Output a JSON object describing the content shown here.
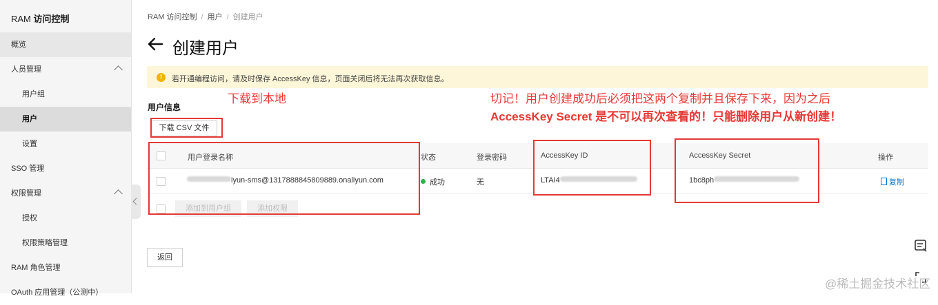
{
  "sidebar": {
    "title_prefix": "RAM",
    "title_main": "访问控制",
    "items": [
      {
        "label": "概览"
      },
      {
        "label": "人员管理"
      },
      {
        "label": "用户组"
      },
      {
        "label": "用户"
      },
      {
        "label": "设置"
      },
      {
        "label": "SSO 管理"
      },
      {
        "label": "权限管理"
      },
      {
        "label": "授权"
      },
      {
        "label": "权限策略管理"
      },
      {
        "label": "RAM 角色管理"
      },
      {
        "label": "OAuth 应用管理（公测中）"
      }
    ]
  },
  "breadcrumb": {
    "items": [
      "RAM 访问控制",
      "用户",
      "创建用户"
    ]
  },
  "page": {
    "title": "创建用户"
  },
  "notice": {
    "icon": "warning-icon",
    "text": "若开通编程访问，请及时保存 AccessKey 信息，页面关闭后将无法再次获取信息。"
  },
  "section": {
    "title": "用户信息"
  },
  "buttons": {
    "download_csv": "下载 CSV 文件",
    "add_to_group": "添加到用户组",
    "add_permission": "添加权限",
    "back": "返回"
  },
  "table": {
    "headers": [
      "用户登录名称",
      "状态",
      "登录密码",
      "AccessKey ID",
      "AccessKey Secret",
      "操作"
    ],
    "row": {
      "login_visible": "iyun-sms@1317888845809889.onaliyun.com",
      "status": "成功",
      "password": "无",
      "access_key_id_visible": "LTAI4",
      "access_key_secret_visible": "1bc8ph",
      "action": "复制"
    }
  },
  "annotations": {
    "download_note": "下载到本地",
    "warning_line1": "切记！用户创建成功后必须把这两个复制并且保存下来，因为之后",
    "warning_line2": "AccessKey Secret 是不可以再次查看的！只能删除用户从新创建！"
  },
  "watermark": "@稀土掘金技术社区",
  "colors": {
    "annotation_red": "#e53935",
    "notice_bg": "#fdf6d8",
    "link_blue": "#0070cc",
    "success_green": "#2fb14a"
  }
}
